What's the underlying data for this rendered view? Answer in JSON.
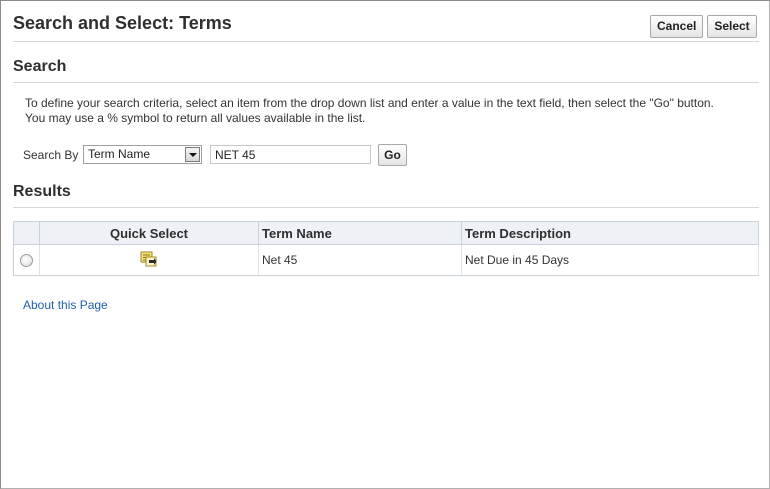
{
  "header": {
    "title": "Search and Select: Terms",
    "cancel_label": "Cancel",
    "select_label": "Select"
  },
  "search": {
    "title": "Search",
    "instructions_line1": "To define your search criteria, select an item from the drop down list and enter a value in the text field, then select the \"Go\" button.",
    "instructions_line2": "You may use a % symbol to return all values available in the list.",
    "search_by_label": "Search By",
    "search_by_value": "Term Name",
    "search_value": "NET 45",
    "go_label": "Go"
  },
  "results": {
    "title": "Results",
    "columns": [
      "Quick Select",
      "Term Name",
      "Term Description"
    ],
    "rows": [
      {
        "term_name": "Net 45",
        "term_description": "Net Due in 45 Days"
      }
    ]
  },
  "footer": {
    "about_link": "About this Page"
  },
  "icons": {
    "quick_select": "quick-select-icon",
    "dropdown": "chevron-down-icon"
  }
}
